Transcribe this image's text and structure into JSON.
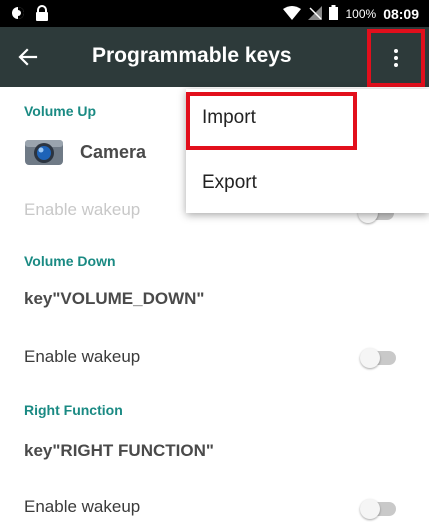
{
  "status_bar": {
    "left_icons": [
      "brightness-icon",
      "lock-icon"
    ],
    "right_icons": [
      "wifi-icon",
      "no-signal-icon",
      "battery-icon"
    ],
    "battery": "100%",
    "time": "08:09"
  },
  "app_bar": {
    "title": "Programmable keys",
    "back_icon": "arrow-left-icon",
    "overflow_icon": "more-vertical-icon"
  },
  "sections": {
    "volume_up": {
      "label": "Volume Up",
      "app_name": "Camera",
      "app_icon": "camera-icon",
      "wakeup_label": "Enable wakeup",
      "wakeup_enabled": false
    },
    "volume_down": {
      "label": "Volume Down",
      "key": "key\"VOLUME_DOWN\"",
      "wakeup_label": "Enable wakeup",
      "wakeup_enabled": false
    },
    "right_function": {
      "label": "Right Function",
      "key": "key\"RIGHT FUNCTION\"",
      "wakeup_label": "Enable wakeup",
      "wakeup_enabled": false
    }
  },
  "overflow_menu": {
    "items": [
      {
        "label": "Import",
        "highlighted": true
      },
      {
        "label": "Export",
        "highlighted": false
      }
    ]
  },
  "colors": {
    "app_bar": "#2d3a3a",
    "accent": "#1a8a83",
    "highlight": "#e20f1c"
  }
}
